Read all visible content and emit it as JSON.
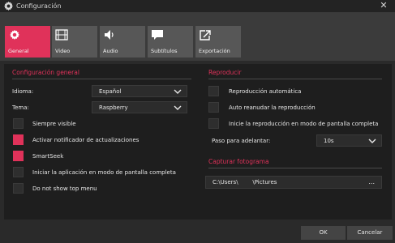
{
  "window": {
    "title": "Configuración"
  },
  "tabs": [
    {
      "label": "General",
      "icon": "gear-icon",
      "active": true
    },
    {
      "label": "Video",
      "icon": "film-icon",
      "active": false
    },
    {
      "label": "Audio",
      "icon": "speaker-icon",
      "active": false
    },
    {
      "label": "Subtítulos",
      "icon": "speech-bubble-icon",
      "active": false
    },
    {
      "label": "Exportación",
      "icon": "export-icon",
      "active": false
    }
  ],
  "general": {
    "section_title": "Configuración general",
    "language_label": "Idioma:",
    "language_value": "Español",
    "theme_label": "Tema:",
    "theme_value": "Raspberry",
    "options": [
      {
        "label": "Siempre visible",
        "checked": false
      },
      {
        "label": "Activar notificador de actualizaciones",
        "checked": true
      },
      {
        "label": "SmartSeek",
        "checked": true
      },
      {
        "label": "Iniciar la aplicación en modo de pantalla completa",
        "checked": false
      },
      {
        "label": "Do not show top menu",
        "checked": false
      }
    ]
  },
  "playback": {
    "section_title": "Reproducir",
    "options": [
      {
        "label": "Reproducción automática",
        "checked": false
      },
      {
        "label": "Auto reanudar la reproducción",
        "checked": false
      },
      {
        "label": "Inicie la reproducción en modo de pantalla completa",
        "checked": false
      }
    ],
    "step_label": "Paso para adelantar:",
    "step_value": "10s"
  },
  "capture": {
    "section_title": "Capturar fotograma",
    "path_value": "C:\\Users\\        \\Pictures",
    "browse_label": "..."
  },
  "buttons": {
    "ok": "OK",
    "cancel": "Cancelar"
  },
  "colors": {
    "accent": "#e0325a",
    "panel": "#1e1e1e",
    "background": "#2a2a2a",
    "tab": "#575757"
  }
}
